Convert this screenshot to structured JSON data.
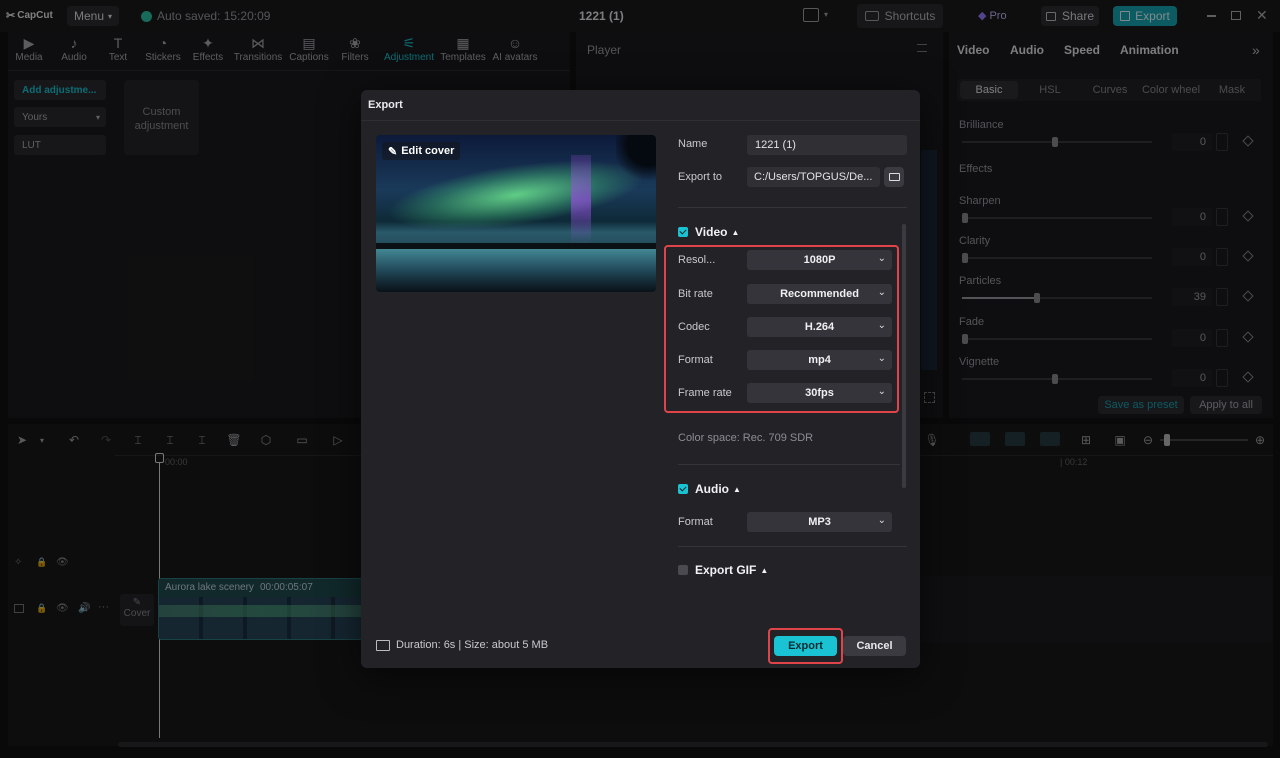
{
  "app": {
    "logo": "CapCut",
    "menu": "Menu",
    "autosave": "Auto saved: 15:20:09",
    "project_title": "1221 (1)",
    "shortcuts": "Shortcuts",
    "pro": "Pro",
    "share": "Share",
    "export": "Export"
  },
  "toolbar": {
    "items": [
      {
        "label": "Media",
        "icon": "media-icon"
      },
      {
        "label": "Audio",
        "icon": "audio-icon"
      },
      {
        "label": "Text",
        "icon": "text-icon"
      },
      {
        "label": "Stickers",
        "icon": "stickers-icon"
      },
      {
        "label": "Effects",
        "icon": "effects-icon"
      },
      {
        "label": "Transitions",
        "icon": "transitions-icon"
      },
      {
        "label": "Captions",
        "icon": "captions-icon"
      },
      {
        "label": "Filters",
        "icon": "filters-icon"
      },
      {
        "label": "Adjustment",
        "icon": "adjustment-icon",
        "active": true
      },
      {
        "label": "Templates",
        "icon": "templates-icon"
      },
      {
        "label": "AI avatars",
        "icon": "ai-avatars-icon"
      }
    ]
  },
  "left": {
    "add_adjustment": "Add adjustme...",
    "yours": "Yours",
    "lut": "LUT",
    "custom_line1": "Custom",
    "custom_line2": "adjustment"
  },
  "player": {
    "title": "Player"
  },
  "right": {
    "tabs": [
      "Video",
      "Audio",
      "Speed",
      "Animation"
    ],
    "subtabs": [
      "Basic",
      "HSL",
      "Curves",
      "Color wheel",
      "Mask"
    ],
    "brilliance": "Brilliance",
    "brilliance_val": "0",
    "effects_title": "Effects",
    "sliders": [
      {
        "label": "Sharpen",
        "value": "0"
      },
      {
        "label": "Clarity",
        "value": "0"
      },
      {
        "label": "Particles",
        "value": "39"
      },
      {
        "label": "Fade",
        "value": "0"
      },
      {
        "label": "Vignette",
        "value": "0"
      }
    ],
    "save_preset": "Save as preset",
    "apply_all": "Apply to all"
  },
  "timeline": {
    "time_start": "00:00",
    "time_end": "| 00:12",
    "clip_label": "Aurora lake scenery",
    "clip_duration": "00:00:05:07",
    "cover": "Cover"
  },
  "dialog": {
    "title": "Export",
    "edit_cover": "Edit cover",
    "name_label": "Name",
    "name_value": "1221 (1)",
    "export_to_label": "Export to",
    "export_to_value": "C:/Users/TOPGUS/De...",
    "video_section": "Video",
    "resolution_label": "Resol...",
    "resolution": "1080P",
    "bitrate_label": "Bit rate",
    "bitrate": "Recommended",
    "codec_label": "Codec",
    "codec": "H.264",
    "format_label": "Format",
    "format": "mp4",
    "framerate_label": "Frame rate",
    "framerate": "30fps",
    "color_space": "Color space: Rec. 709 SDR",
    "audio_section": "Audio",
    "audio_format_label": "Format",
    "audio_format": "MP3",
    "gif_section": "Export GIF",
    "footer_info": "Duration: 6s | Size: about 5 MB",
    "export_btn": "Export",
    "cancel_btn": "Cancel"
  },
  "colors": {
    "accent": "#19c3d3",
    "highlight": "#e0444b"
  }
}
